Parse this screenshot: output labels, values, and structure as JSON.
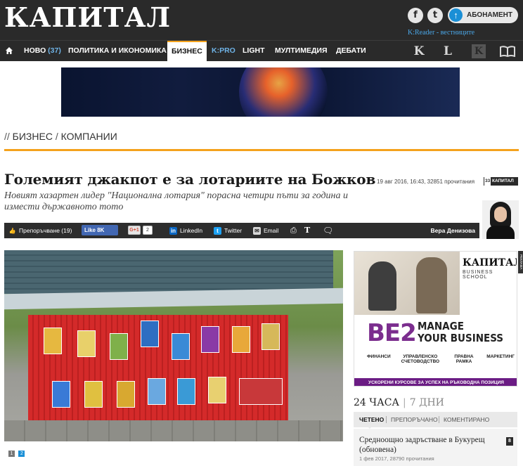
{
  "header": {
    "logo": "КАПИТАЛ",
    "subscribe_label": "АБОНАМЕНТ",
    "kreader": "K:Reader - вестниците",
    "social": {
      "facebook": "f",
      "twitter": "t"
    }
  },
  "nav": {
    "items": [
      {
        "label": "НОВО",
        "count": "(37)"
      },
      {
        "label": "ПОЛИТИКА И ИКОНОМИКА"
      },
      {
        "label": "БИЗНЕС",
        "active": true
      },
      {
        "label": "K:PRO"
      },
      {
        "label": "LIGHT"
      },
      {
        "label": "МУЛТИМЕДИЯ"
      },
      {
        "label": "ДЕБАТИ"
      }
    ],
    "right_icons": [
      "K",
      "L",
      "K"
    ]
  },
  "breadcrumb": {
    "prefix": "//",
    "items": [
      "БИЗНЕС",
      "КОМПАНИИ"
    ]
  },
  "article": {
    "title": "Големият джакпот е за лотариите на Божков",
    "subtitle": "Новият хазартен лидер \"Национална лотария\" порасна четири пъти за година и измести държавното тото",
    "meta": "19 авг 2016, 16:43, 32851 прочитания",
    "badge_num": "33",
    "badge_text": "КАПИТАЛ",
    "author": "Вера Денизова"
  },
  "share": {
    "recommend": "Препоръчване (19)",
    "fb_like": "Like 8K",
    "gplus": "G+1",
    "gplus_count": "2",
    "linkedin": "LinkedIn",
    "twitter": "Twitter",
    "email": "Email"
  },
  "gallery": {
    "pages": [
      "1",
      "2"
    ],
    "current": "2"
  },
  "ad": {
    "brand": "КАПИТАЛ",
    "school": "BUSINESS SCHOOL",
    "be2": "BE2",
    "manage_line1": "MANAGE",
    "manage_line2": "YOUR BUSINESS",
    "topics": [
      "ФИНАНСИ",
      "УПРАВЛЕНСКО СЧЕТОВОДСТВО",
      "ПРАВНА РАМКА",
      "МАРКЕТИНГ"
    ],
    "strip": "УСКОРЕНИ КУРСОВЕ ЗА УСПЕХ НА РЪКОВОДНА ПОЗИЦИЯ",
    "side_tag": "РЕКЛАМА"
  },
  "sidebar": {
    "period_active": "24 ЧАСА",
    "period_other": "7 ДНИ",
    "tabs": [
      "ЧЕТЕНО",
      "ПРЕПОРЪЧАНО",
      "КОМЕНТИРАНО"
    ],
    "news": [
      {
        "title": "Средноощно задръстване в Букурещ (обновена)",
        "meta": "1 фев 2017, 28790 прочитания",
        "num": "8"
      }
    ]
  }
}
